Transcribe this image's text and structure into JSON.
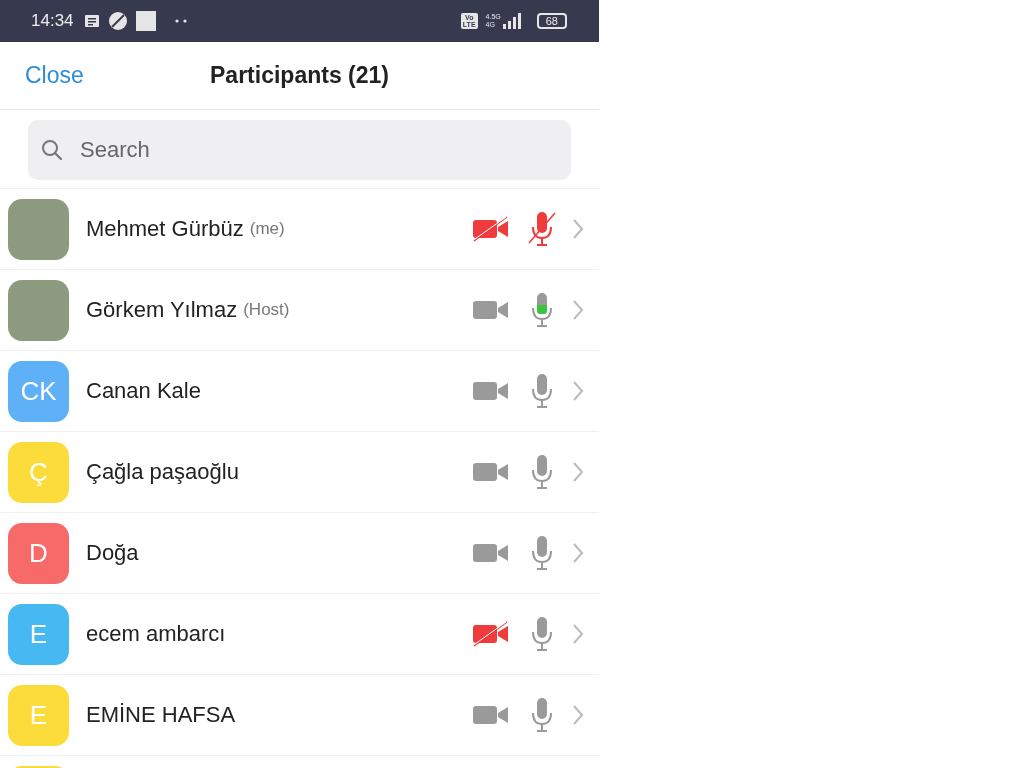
{
  "status_bar": {
    "time": "14:34",
    "volte": [
      "Vo",
      "LTE"
    ],
    "network": "4.5G",
    "network_sub": "4G",
    "battery": "68"
  },
  "header": {
    "close": "Close",
    "title": "Participants (21)"
  },
  "search": {
    "placeholder": "Search"
  },
  "participants": [
    {
      "avatar": {
        "kind": "photo"
      },
      "name": "Mehmet Gürbüz",
      "tag": "(me)",
      "video_blocked": true,
      "muted": true,
      "speaking": false
    },
    {
      "avatar": {
        "kind": "photo"
      },
      "name": "Görkem Yılmaz",
      "tag": "(Host)",
      "video_blocked": false,
      "muted": false,
      "speaking": true
    },
    {
      "avatar": {
        "kind": "initials",
        "initials": "CK",
        "color": "#5eb1f7"
      },
      "name": "Canan Kale",
      "video_blocked": false,
      "muted": false,
      "speaking": false
    },
    {
      "avatar": {
        "kind": "initials",
        "initials": "Ç",
        "color": "#fcdc3a"
      },
      "name": "Çağla paşaoğlu",
      "video_blocked": false,
      "muted": false,
      "speaking": false
    },
    {
      "avatar": {
        "kind": "initials",
        "initials": "D",
        "color": "#f76a6a"
      },
      "name": "Doğa",
      "video_blocked": false,
      "muted": false,
      "speaking": false
    },
    {
      "avatar": {
        "kind": "initials",
        "initials": "E",
        "color": "#46b9f2"
      },
      "name": "ecem ambarcı",
      "video_blocked": true,
      "muted": false,
      "speaking": false
    },
    {
      "avatar": {
        "kind": "initials",
        "initials": "E",
        "color": "#fcdc3a"
      },
      "name": "EMİNE HAFSA",
      "video_blocked": false,
      "muted": false,
      "speaking": false
    },
    {
      "avatar": {
        "kind": "initials",
        "color": "#fcdc3a"
      }
    }
  ]
}
